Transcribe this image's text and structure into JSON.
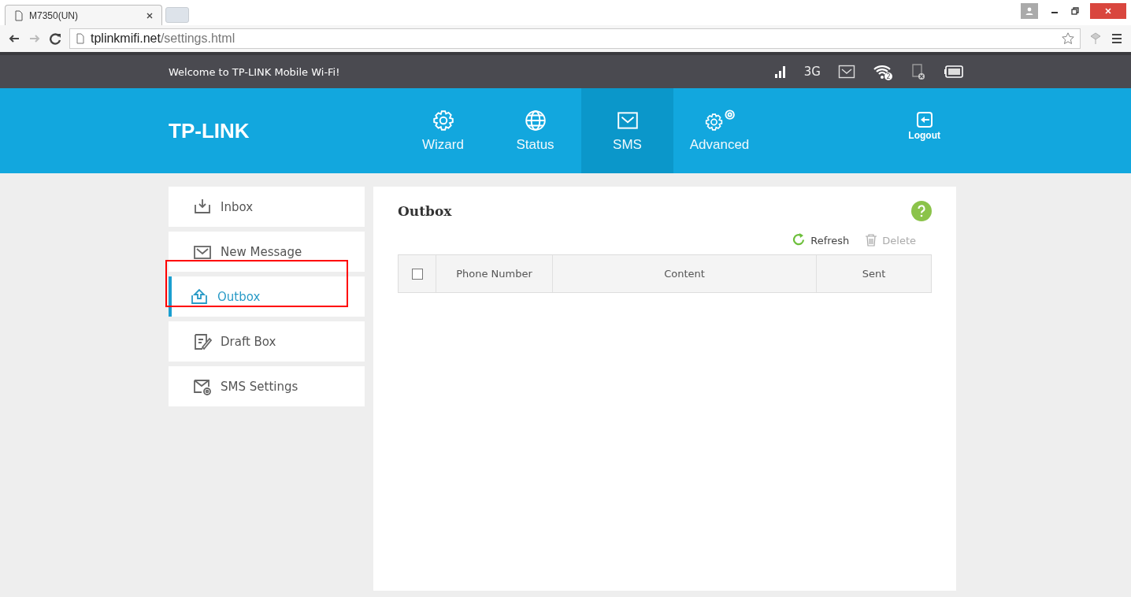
{
  "browser": {
    "tab_title": "M7350(UN)",
    "url_host": "tplinkmifi.net",
    "url_path": "/settings.html"
  },
  "status_bar": {
    "welcome": "Welcome to TP-LINK Mobile Wi-Fi!",
    "network": "3G",
    "wifi_clients": "2"
  },
  "header": {
    "logo": "TP-LINK",
    "logout": "Logout",
    "nav": [
      {
        "label": "Wizard",
        "kind": "gear",
        "selected": false
      },
      {
        "label": "Status",
        "kind": "globe",
        "selected": false
      },
      {
        "label": "SMS",
        "kind": "mail",
        "selected": true
      },
      {
        "label": "Advanced",
        "kind": "gears",
        "selected": false
      }
    ]
  },
  "sidebar": {
    "items": [
      {
        "label": "Inbox",
        "kind": "inbox",
        "selected": false
      },
      {
        "label": "New Message",
        "kind": "mail",
        "selected": false
      },
      {
        "label": "Outbox",
        "kind": "outbox",
        "selected": true
      },
      {
        "label": "Draft Box",
        "kind": "draft",
        "selected": false
      },
      {
        "label": "SMS Settings",
        "kind": "settings",
        "selected": false
      }
    ]
  },
  "panel": {
    "title": "Outbox",
    "actions": [
      {
        "label": "Refresh",
        "kind": "refresh",
        "disabled": false
      },
      {
        "label": "Delete",
        "kind": "delete",
        "disabled": true
      }
    ],
    "table": {
      "select_all": {
        "checked": false
      },
      "columns": [
        "Phone Number",
        "Content",
        "Sent"
      ]
    }
  }
}
